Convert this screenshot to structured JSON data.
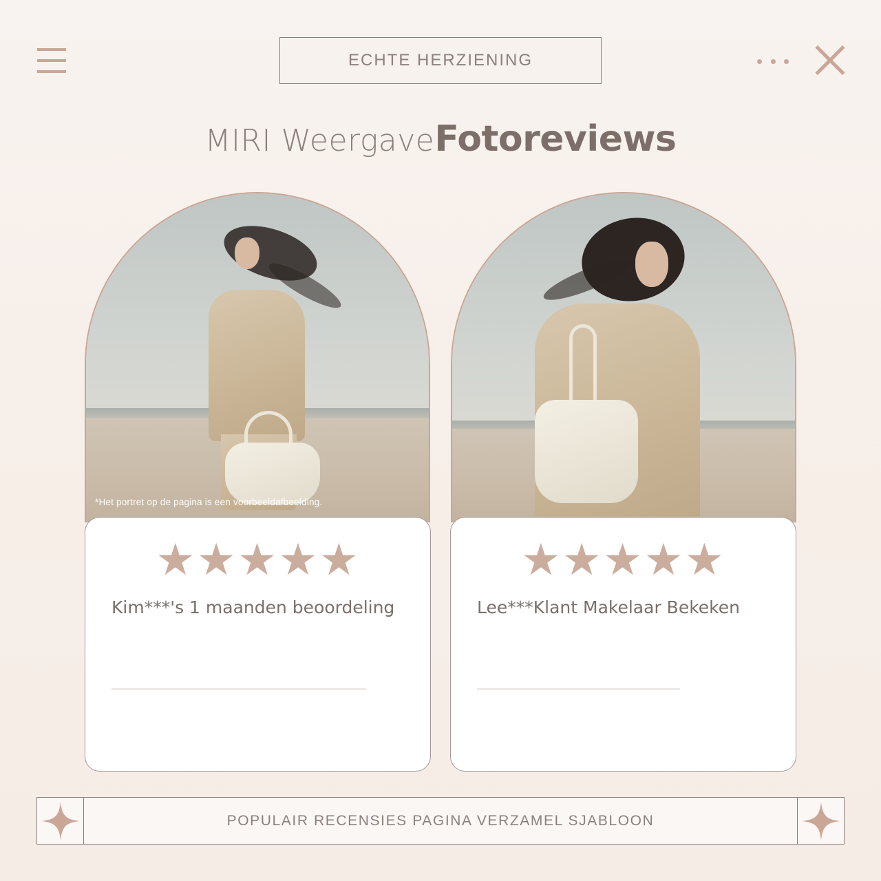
{
  "header": {
    "badge": "ECHTE HERZIENING",
    "title_light": "MIRI Weergave",
    "title_bold": "Fotoreviews"
  },
  "icons": {
    "menu": "hamburger-menu-icon",
    "more": "more-dots-icon",
    "close": "close-x-icon",
    "sparkle": "four-point-star-icon"
  },
  "reviews": [
    {
      "stars": "★★★★★",
      "rating": 5,
      "reviewer": "Kim***'s 1 maanden beoordeling",
      "photo_note": "*Het portret op de pagina is een voorbeeldafbeelding."
    },
    {
      "stars": "★★★★★",
      "rating": 5,
      "reviewer": "Lee***Klant Makelaar Bekeken"
    }
  ],
  "footer": {
    "label": "POPULAIR RECENSIES PAGINA VERZAMEL SJABLOON"
  },
  "colors": {
    "accent": "#c9a696",
    "star": "#cbad9e",
    "text": "#7a6f6b",
    "border": "#8a7f7b"
  }
}
